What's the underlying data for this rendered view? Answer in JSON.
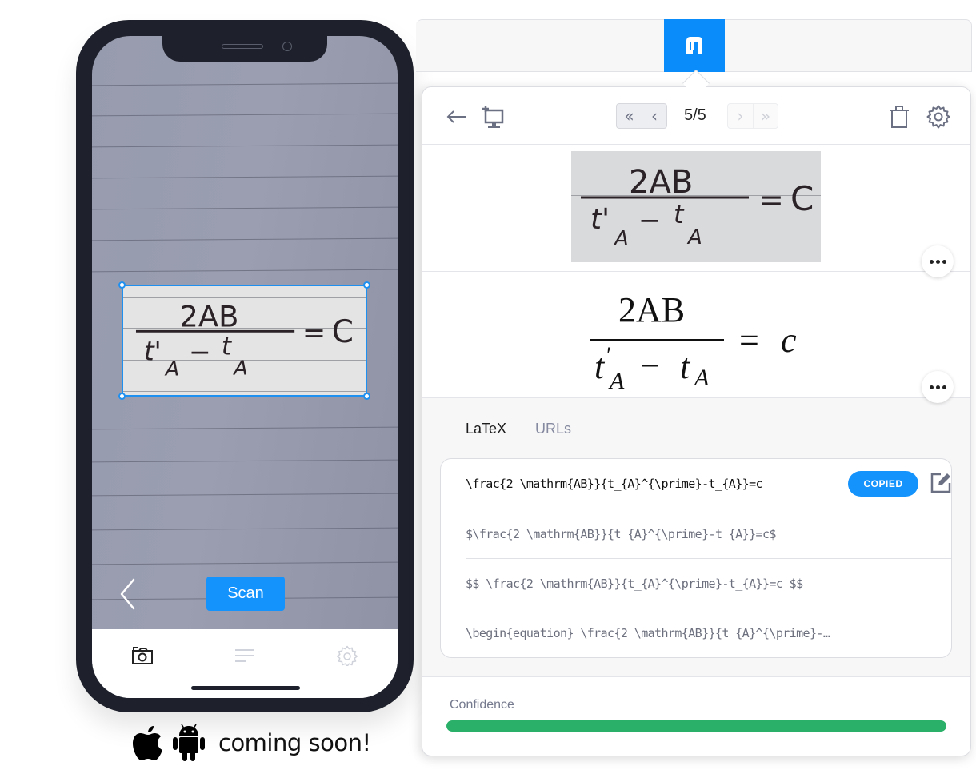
{
  "phone": {
    "scan_button_label": "Scan",
    "tabbar": [
      {
        "icon": "camera-icon",
        "active": true
      },
      {
        "icon": "list-icon",
        "active": false
      },
      {
        "icon": "gear-icon",
        "active": false
      }
    ],
    "handwritten_equation": {
      "numerator": "2AB",
      "denominator_left": "t'",
      "denominator_left_sub": "A",
      "minus": "−",
      "denominator_right": "t",
      "denominator_right_sub": "A",
      "equals": "=",
      "rhs": "C"
    }
  },
  "platforms": {
    "icons": [
      "apple-icon",
      "android-icon"
    ],
    "coming_soon_text": "coming soon!"
  },
  "extension": {
    "brand_icon": "mathpix-logo-icon",
    "accent_color": "#0a8dfa",
    "header": {
      "back_icon": "arrow-left-icon",
      "screenshot_icon": "screen-capture-icon",
      "first_icon": "«",
      "prev_icon": "‹",
      "page_indicator": "5/5",
      "next_icon": "›",
      "last_icon": "»",
      "delete_icon": "trash-icon",
      "settings_icon": "gear-icon"
    },
    "rendered": {
      "numerator": "2AB",
      "t": "t",
      "prime": "′",
      "sub": "A",
      "minus": "−",
      "equals": "=",
      "rhs": "c"
    },
    "tabs": [
      {
        "label": "LaTeX",
        "active": true
      },
      {
        "label": "URLs",
        "active": false
      }
    ],
    "latex_results": [
      {
        "text": "\\frac{2 \\mathrm{AB}}{t_{A}^{\\prime}-t_{A}}=c",
        "primary": true
      },
      {
        "text": "$\\frac{2 \\mathrm{AB}}{t_{A}^{\\prime}-t_{A}}=c$",
        "primary": false
      },
      {
        "text": "$$ \\frac{2 \\mathrm{AB}}{t_{A}^{\\prime}-t_{A}}=c $$",
        "primary": false
      },
      {
        "text": "\\begin{equation} \\frac{2 \\mathrm{AB}}{t_{A}^{\\prime}-…",
        "primary": false
      }
    ],
    "copied_badge": "COPIED",
    "confidence": {
      "label": "Confidence",
      "value_percent": 100,
      "color": "#2ab068"
    }
  }
}
